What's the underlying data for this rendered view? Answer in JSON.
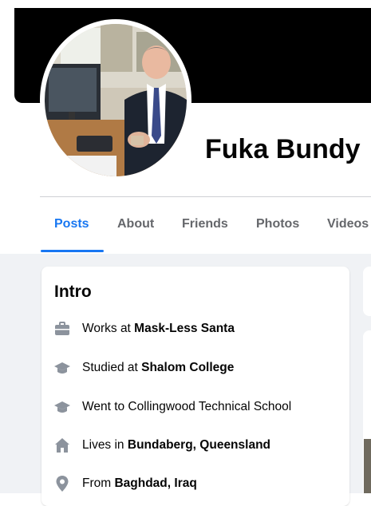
{
  "profile": {
    "name": "Fuka Bundy"
  },
  "tabs": [
    {
      "label": "Posts",
      "active": true
    },
    {
      "label": "About",
      "active": false
    },
    {
      "label": "Friends",
      "active": false
    },
    {
      "label": "Photos",
      "active": false
    },
    {
      "label": "Videos",
      "active": false
    }
  ],
  "intro": {
    "title": "Intro",
    "items": [
      {
        "icon": "briefcase-icon",
        "prefix": "Works at ",
        "value": "Mask-Less Santa"
      },
      {
        "icon": "graduation-cap-icon",
        "prefix": "Studied at ",
        "value": "Shalom College"
      },
      {
        "icon": "graduation-cap-icon",
        "prefix": "Went to Collingwood Technical School",
        "value": ""
      },
      {
        "icon": "home-icon",
        "prefix": "Lives in ",
        "value": "Bundaberg, Queensland"
      },
      {
        "icon": "location-pin-icon",
        "prefix": "From ",
        "value": "Baghdad, Iraq"
      }
    ]
  },
  "colors": {
    "accent": "#1877f2",
    "icon_gray": "#8c939d",
    "text": "#050505",
    "muted_text": "#65676b",
    "page_bg": "#f0f2f5"
  }
}
